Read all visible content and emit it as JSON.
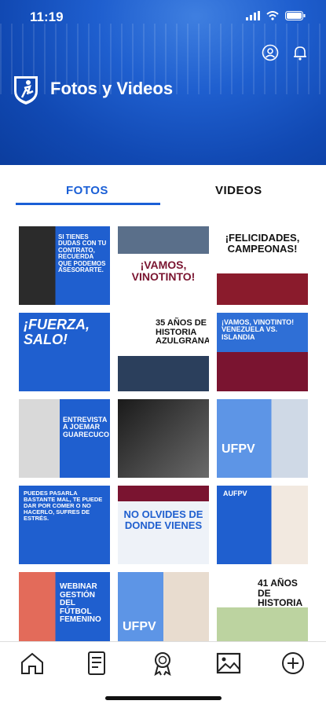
{
  "status_bar": {
    "time": "11:19"
  },
  "header": {
    "title": "Fotos y Videos"
  },
  "tabs": [
    {
      "label": "FOTOS",
      "active": true
    },
    {
      "label": "VIDEOS",
      "active": false
    }
  ],
  "tiles": [
    {
      "text": "SI TIENES DUDAS CON TU CONTRATO, RECUERDA QUE PODEMOS ASESORARTE."
    },
    {
      "text": "¡VAMOS, VINOTINTO!"
    },
    {
      "text": "¡FELICIDADES, CAMPEONAS!"
    },
    {
      "text": "¡FUERZA, SALO!"
    },
    {
      "text": "35 AÑOS DE HISTORIA AZULGRANA"
    },
    {
      "text": "¡VAMOS, VINOTINTO! VENEZUELA VS. ISLANDIA"
    },
    {
      "text": "ENTREVISTA A JOEMAR GUARECUCO"
    },
    {
      "text": ""
    },
    {
      "text": "UFPV"
    },
    {
      "text": "PUEDES PASARLA BASTANTE MAL, TE PUEDE DAR POR COMER O NO HACERLO, SUFRES DE ESTRÉS."
    },
    {
      "text": "NO OLVIDES DE DONDE VIENES"
    },
    {
      "text": "AUFPV"
    },
    {
      "text": "WEBINAR GESTIÓN DEL FÚTBOL FEMENINO"
    },
    {
      "text": "UFPV"
    },
    {
      "text": "41 AÑOS DE HISTORIA"
    }
  ],
  "colors": {
    "brand_blue": "#1149b3",
    "accent": "#1a5fd6"
  },
  "nav": [
    {
      "icon": "home-icon"
    },
    {
      "icon": "document-icon"
    },
    {
      "icon": "award-icon"
    },
    {
      "icon": "gallery-icon",
      "active": true
    },
    {
      "icon": "plus-circle-icon"
    }
  ]
}
